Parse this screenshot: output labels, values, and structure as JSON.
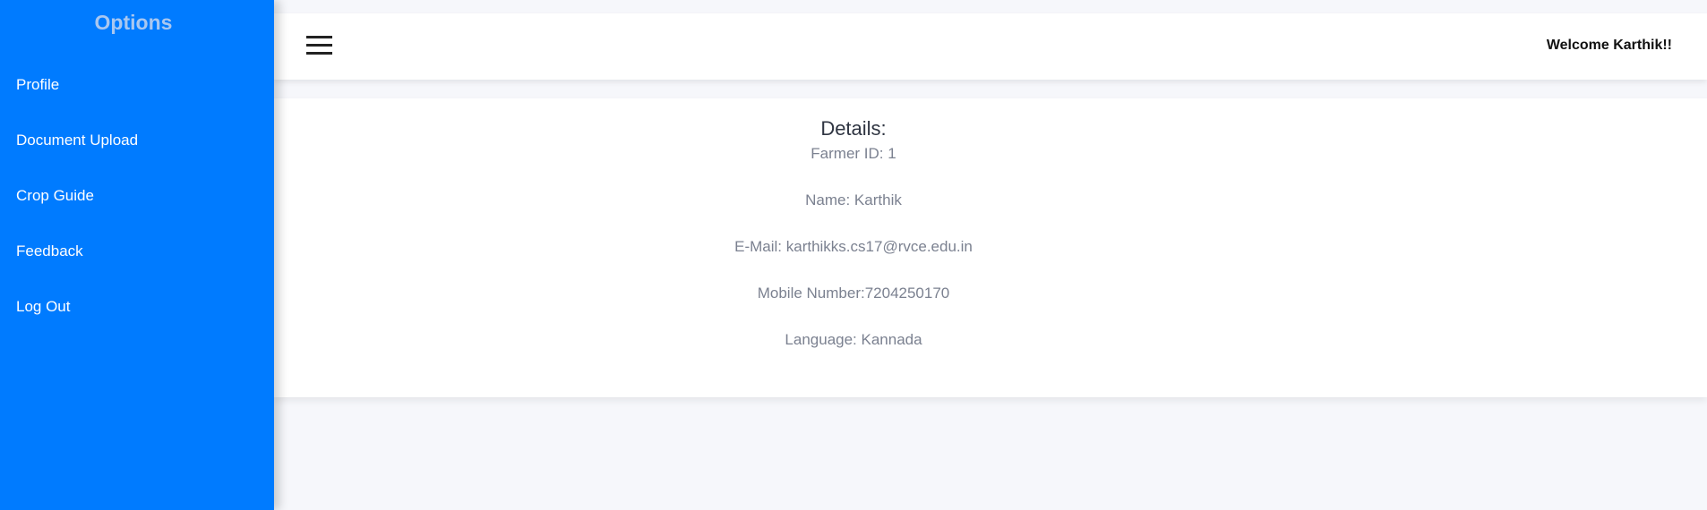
{
  "sidebar": {
    "title": "Options",
    "items": [
      {
        "label": "Profile"
      },
      {
        "label": "Document Upload"
      },
      {
        "label": "Crop Guide"
      },
      {
        "label": "Feedback"
      },
      {
        "label": "Log Out"
      }
    ]
  },
  "header": {
    "menu_icon": "hamburger-menu-icon",
    "welcome": "Welcome Karthik!!"
  },
  "details": {
    "heading": "Details:",
    "farmer_id": "Farmer ID: 1",
    "name": "Name: Karthik",
    "email": "E-Mail: karthikks.cs17@rvce.edu.in",
    "mobile": "Mobile Number:7204250170",
    "language": "Language: Kannada"
  },
  "colors": {
    "sidebar_bg": "#007bff",
    "page_bg": "#f6f7fb",
    "card_bg": "#ffffff"
  }
}
